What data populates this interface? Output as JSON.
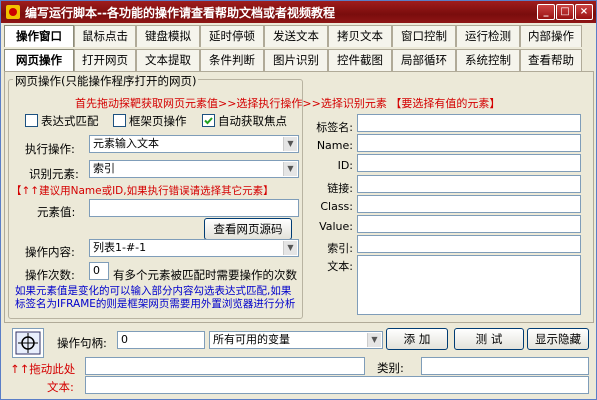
{
  "window": {
    "title": "编写运行脚本--各功能的操作请查看帮助文档或者视频教程",
    "minimize": "_",
    "maximize": "□",
    "close": "×"
  },
  "tabs_row1": [
    "操作窗口",
    "鼠标点击",
    "键盘模拟",
    "延时停顿",
    "发送文本",
    "拷贝文本",
    "窗口控制",
    "运行检测",
    "内部操作"
  ],
  "tabs_row2": [
    "网页操作",
    "打开网页",
    "文本提取",
    "条件判断",
    "图片识别",
    "控件截图",
    "局部循环",
    "系统控制",
    "查看帮助"
  ],
  "group": {
    "title": "网页操作(只能操作程序打开的网页)",
    "hint_top": "首先拖动探靶获取网页元素值>>选择执行操作>>选择识别元素 【要选择有值的元素】",
    "regex_label": "表达式匹配",
    "frame_label": "框架页操作",
    "autofocus_label": "自动获取焦点",
    "action_label": "执行操作:",
    "action_value": "元素输入文本",
    "identify_label": "识别元素:",
    "identify_value": "索引",
    "identify_hint": "【↑↑建议用Name或ID,如果执行错误请选择其它元素】",
    "element_value_label": "元素值:",
    "element_value": "",
    "view_source_button": "查看网页源码",
    "content_label": "操作内容:",
    "content_value": "列表1-#-1",
    "count_label": "操作次数:",
    "count_value": "0",
    "count_hint": "有多个元素被匹配时需要操作的次数",
    "bottom_hint": "如果元素值是变化的可以输入部分内容勾选表达式匹配,如果标签名为IFRAME的则是框架网页需要用外置浏览器进行分析"
  },
  "props": {
    "tag_label": "标签名:",
    "name_label": "Name:",
    "id_label": "ID:",
    "link_label": "链接:",
    "class_label": "Class:",
    "value_label": "Value:",
    "index_label": "索引:",
    "text_label": "文本:"
  },
  "bottom": {
    "handle_label": "操作句柄:",
    "handle_value": "0",
    "vars_value": "所有可用的变量",
    "add_button": "添 加",
    "test_button": "测 试",
    "toggle_button": "显示隐藏",
    "drag_label": "↑↑拖动此处",
    "category_label": "类别:",
    "text_label": "文本:"
  },
  "colors": {
    "title_bg": "#8f1515",
    "hint_red": "#d40000",
    "blue_text": "#0000cc"
  }
}
